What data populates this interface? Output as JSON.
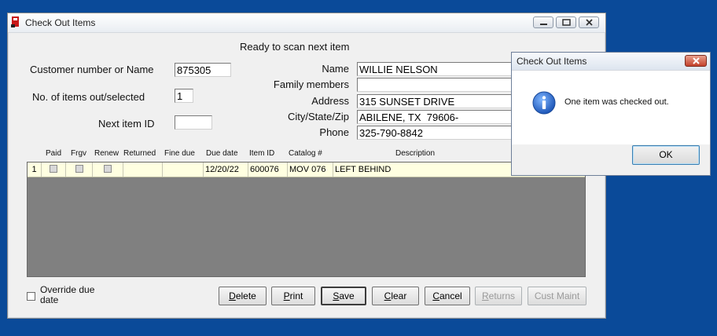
{
  "window": {
    "title": "Check Out Items",
    "status": "Ready to scan next item"
  },
  "form": {
    "customer_label": "Customer number or Name",
    "customer_value": "875305",
    "items_label": "No. of items out/selected",
    "items_value": "1",
    "next_item_label": "Next item ID",
    "next_item_value": "",
    "name_label": "Name",
    "name_value": "WILLIE NELSON",
    "family_label": "Family members",
    "family_value": "",
    "address_label": "Address",
    "address_value": "315 SUNSET DRIVE",
    "city_label": "City/State/Zip",
    "city_value": "ABILENE, TX  79606-",
    "phone_label": "Phone",
    "phone_value": "325-790-8842"
  },
  "grid": {
    "columns": [
      "Paid",
      "Frgv",
      "Renew",
      "Returned",
      "Fine due",
      "Due date",
      "Item ID",
      "Catalog #",
      "Description"
    ],
    "rows": [
      {
        "num": "1",
        "paid": false,
        "frgv": false,
        "renew": false,
        "returned": "",
        "fine_due": "",
        "due_date": "12/20/22",
        "item_id": "600076",
        "catalog": "MOV 076",
        "description": "LEFT BEHIND"
      }
    ]
  },
  "override": {
    "label_line1": "Override due",
    "label_line2": "date",
    "checked": false
  },
  "buttons": {
    "delete": "Delete",
    "print": "Print",
    "save": "Save",
    "clear": "Clear",
    "cancel": "Cancel",
    "returns": "Returns",
    "cust_maint": "Cust Maint"
  },
  "dialog": {
    "title": "Check Out Items",
    "message": "One item was checked out.",
    "ok": "OK",
    "icon": "info-icon"
  },
  "colors": {
    "desktop": "#0a4a99",
    "grid_row": "#ffffe1",
    "grid_bg": "#808080",
    "info_icon": "#2a6ad0"
  }
}
